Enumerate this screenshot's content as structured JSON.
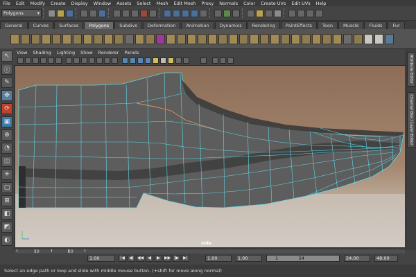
{
  "menubar": {
    "items": [
      "File",
      "Edit",
      "Modify",
      "Create",
      "Display",
      "Window",
      "Assets",
      "Select",
      "Mesh",
      "Edit Mesh",
      "Proxy",
      "Normals",
      "Color",
      "Create UVs",
      "Edit UVs",
      "Help"
    ]
  },
  "toolbar": {
    "mode_selector": "Polygons"
  },
  "shelf": {
    "tabs": [
      "General",
      "Curves",
      "Surfaces",
      "Polygons",
      "Subdivs",
      "Deformation",
      "Animation",
      "Dynamics",
      "Rendering",
      "PaintEffects",
      "Toon",
      "Muscle",
      "Fluids",
      "Fur"
    ],
    "active_tab": "Polygons"
  },
  "panel": {
    "menu": [
      "View",
      "Shading",
      "Lighting",
      "Show",
      "Renderer",
      "Panels"
    ],
    "camera_label": "side"
  },
  "right_tabs": {
    "attribute_editor": "Attribute Editor",
    "channel_box": "Channel Box / Layer Editor"
  },
  "time_slider": {
    "ticks": [
      "10",
      "20"
    ]
  },
  "range": {
    "current_time": "1.00",
    "start_time": "1.00",
    "range_start": "1.00",
    "range_slider_start": "1",
    "range_slider_end": "24",
    "end_time": "24.00",
    "range_end": "48.00"
  },
  "help_line": "Select an edge path or loop and slide with middle mouse button. (+shift for move along normal)",
  "colors": {
    "wire": "#5fd9e8",
    "mesh": "#5a5a5a",
    "selected_edge": "#e0955a",
    "ui_bg": "#444444"
  }
}
